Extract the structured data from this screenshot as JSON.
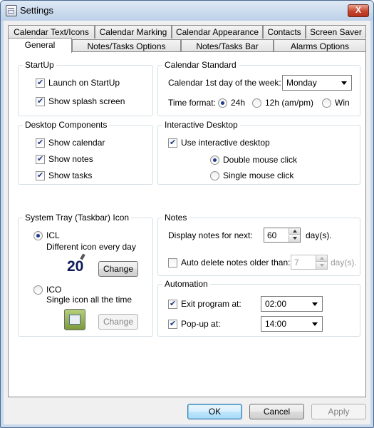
{
  "window": {
    "title": "Settings",
    "close_label": "X"
  },
  "tabs": {
    "row1": [
      "Calendar Text/Icons",
      "Calendar Marking",
      "Calendar Appearance",
      "Contacts",
      "Screen Saver"
    ],
    "row2": [
      "General",
      "Notes/Tasks Options",
      "Notes/Tasks Bar",
      "Alarms Options"
    ],
    "active": "General"
  },
  "startup": {
    "title": "StartUp",
    "launch_label": "Launch on StartUp",
    "splash_label": "Show splash screen"
  },
  "calendar_standard": {
    "title": "Calendar Standard",
    "first_day_label": "Calendar 1st day of the week:",
    "first_day_value": "Monday",
    "time_format_label": "Time format:",
    "opt_24h": "24h",
    "opt_12h": "12h (am/pm)",
    "opt_win": "Win",
    "selected": "24h"
  },
  "desktop_components": {
    "title": "Desktop Components",
    "show_calendar": "Show calendar",
    "show_notes": "Show notes",
    "show_tasks": "Show tasks"
  },
  "interactive_desktop": {
    "title": "Interactive Desktop",
    "use_label": "Use interactive desktop",
    "double_click": "Double mouse click",
    "single_click": "Single mouse click",
    "selected": "Double mouse click"
  },
  "tray": {
    "title": "System Tray (Taskbar) Icon",
    "icl_label": "ICL",
    "icl_desc": "Different icon every day",
    "icl_icon_text": "20",
    "ico_label": "ICO",
    "ico_desc": "Single icon all the time",
    "change_label": "Change",
    "selected": "ICL"
  },
  "notes": {
    "title": "Notes",
    "display_label": "Display notes for next:",
    "display_value": "60",
    "days_unit": "day(s).",
    "auto_delete_label": "Auto delete notes older than:",
    "auto_delete_value": "7",
    "auto_delete_unit": "day(s)."
  },
  "automation": {
    "title": "Automation",
    "exit_label": "Exit program at:",
    "exit_value": "02:00",
    "popup_label": "Pop-up at:",
    "popup_value": "14:00"
  },
  "buttons": {
    "ok": "OK",
    "cancel": "Cancel",
    "apply": "Apply"
  },
  "colors": {
    "titlebar": "#bcd0e8",
    "close_button": "#c8442c",
    "check_mark": "#1d3b8a"
  }
}
